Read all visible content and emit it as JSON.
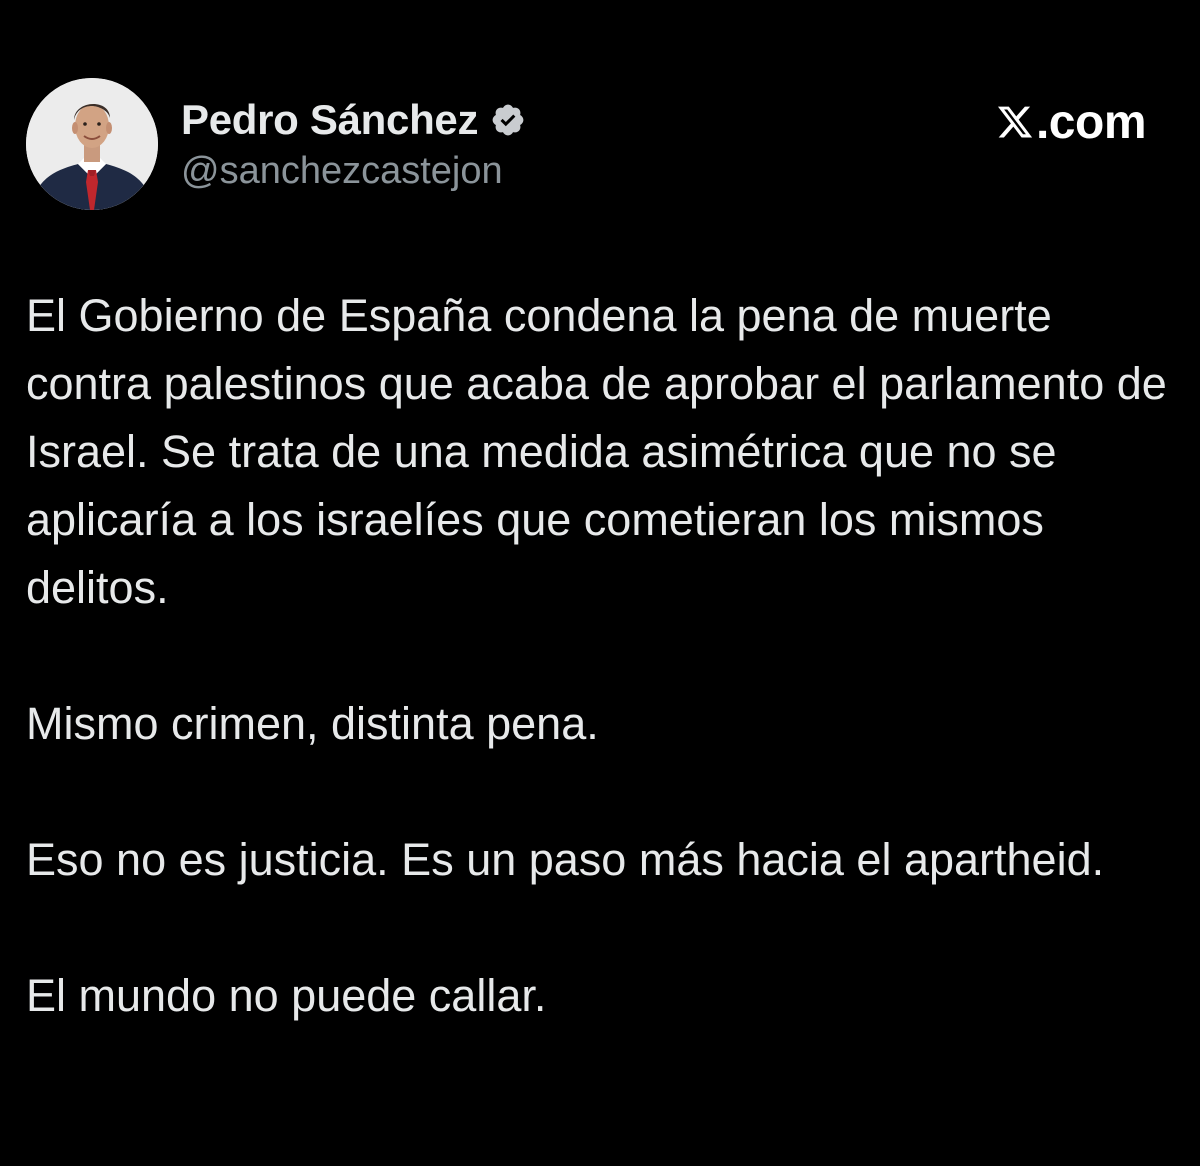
{
  "author": {
    "display_name": "Pedro Sánchez",
    "handle": "@sanchezcastejon",
    "verified": true,
    "avatar_icon": "profile-photo"
  },
  "brand": {
    "label": ".com",
    "logo_icon": "x-logo-icon"
  },
  "colors": {
    "background": "#000000",
    "text": "#e7e9ea",
    "handle": "#8b949a",
    "verified_badge": "#c9ccd0"
  },
  "tweet": {
    "paragraphs": [
      "El Gobierno de España condena la pena de muerte contra palestinos que acaba de aprobar el parlamento de Israel. Se trata de una medida asimétrica que no se aplicaría a los israelíes que cometieran los mismos delitos.",
      "Mismo crimen, distinta pena.",
      "Eso no es justicia. Es un paso más hacia el apartheid.",
      "El mundo no puede callar."
    ]
  }
}
